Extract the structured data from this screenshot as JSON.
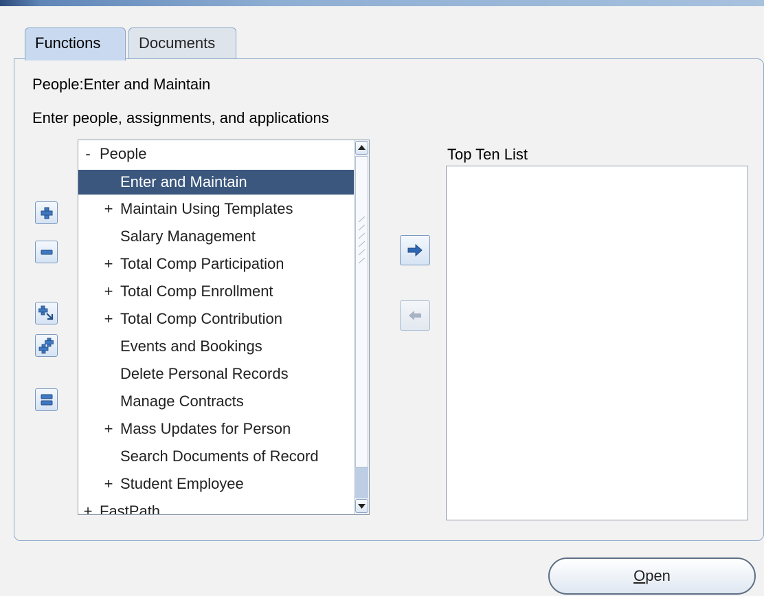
{
  "tabs": [
    {
      "label": "Functions",
      "active": true
    },
    {
      "label": "Documents",
      "active": false
    }
  ],
  "function_title": "People:Enter and Maintain",
  "function_description": "Enter people, assignments, and applications",
  "tree": {
    "rows": [
      {
        "expander": "-",
        "label": "People",
        "level": 0
      },
      {
        "expander": "",
        "label": "Enter and Maintain",
        "level": 1,
        "selected": true
      },
      {
        "expander": "+",
        "label": "Maintain Using Templates",
        "level": 1
      },
      {
        "expander": "",
        "label": "Salary Management",
        "level": 1
      },
      {
        "expander": "+",
        "label": "Total Comp Participation",
        "level": 1
      },
      {
        "expander": "+",
        "label": "Total Comp Enrollment",
        "level": 1
      },
      {
        "expander": "+",
        "label": "Total Comp Contribution",
        "level": 1
      },
      {
        "expander": "",
        "label": "Events and Bookings",
        "level": 1
      },
      {
        "expander": "",
        "label": "Delete Personal Records",
        "level": 1
      },
      {
        "expander": "",
        "label": "Manage Contracts",
        "level": 1
      },
      {
        "expander": "+",
        "label": "Mass Updates for Person",
        "level": 1
      },
      {
        "expander": "",
        "label": "Search Documents of Record",
        "level": 1
      },
      {
        "expander": "+",
        "label": "Student Employee",
        "level": 1
      },
      {
        "expander": "+",
        "label": "FastPath",
        "level": 0
      }
    ]
  },
  "top_ten": {
    "label": "Top Ten List",
    "items": []
  },
  "open_button": {
    "mnemonic": "O",
    "rest": "pen"
  },
  "colors": {
    "selection": "#3b577e",
    "tab_active": "#c9daf0",
    "border": "#8aa7c8"
  }
}
